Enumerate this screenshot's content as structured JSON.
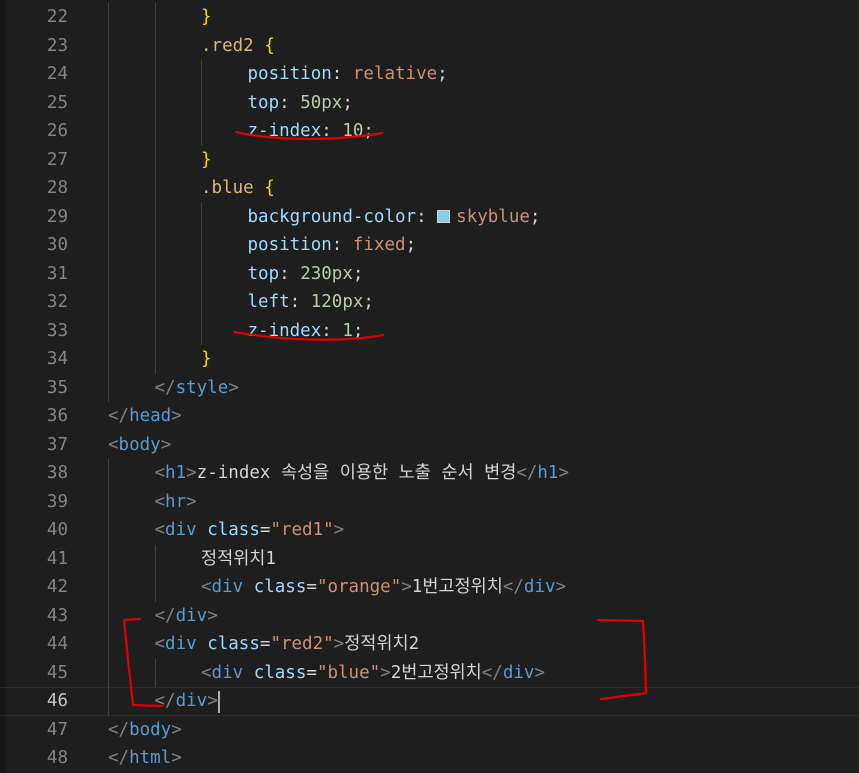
{
  "editor": {
    "swatch_color": "#87ceeb",
    "annotation_color": "#e00000",
    "current_line": 46,
    "lines": [
      {
        "n": "22",
        "indent": 2,
        "tokens": [
          [
            "t-br",
            "}"
          ]
        ]
      },
      {
        "n": "23",
        "indent": 2,
        "tokens": [
          [
            "t-sel",
            ".red2"
          ],
          [
            "t-pun",
            " "
          ],
          [
            "t-br",
            "{"
          ]
        ]
      },
      {
        "n": "24",
        "indent": 3,
        "tokens": [
          [
            "t-prop",
            "position"
          ],
          [
            "t-pun",
            ": "
          ],
          [
            "t-val",
            "relative"
          ],
          [
            "t-pun",
            ";"
          ]
        ]
      },
      {
        "n": "25",
        "indent": 3,
        "tokens": [
          [
            "t-prop",
            "top"
          ],
          [
            "t-pun",
            ": "
          ],
          [
            "t-num",
            "50px"
          ],
          [
            "t-pun",
            ";"
          ]
        ]
      },
      {
        "n": "26",
        "indent": 3,
        "tokens": [
          [
            "t-prop",
            "z-index"
          ],
          [
            "t-pun",
            ": "
          ],
          [
            "t-num",
            "10"
          ],
          [
            "t-pun",
            ";"
          ]
        ]
      },
      {
        "n": "27",
        "indent": 2,
        "tokens": [
          [
            "t-br",
            "}"
          ]
        ]
      },
      {
        "n": "28",
        "indent": 2,
        "tokens": [
          [
            "t-sel",
            ".blue"
          ],
          [
            "t-pun",
            " "
          ],
          [
            "t-br",
            "{"
          ]
        ]
      },
      {
        "n": "29",
        "indent": 3,
        "tokens": [
          [
            "t-prop",
            "background-color"
          ],
          [
            "t-pun",
            ": "
          ],
          [
            "swatch",
            ""
          ],
          [
            "t-val",
            "skyblue"
          ],
          [
            "t-pun",
            ";"
          ]
        ]
      },
      {
        "n": "30",
        "indent": 3,
        "tokens": [
          [
            "t-prop",
            "position"
          ],
          [
            "t-pun",
            ": "
          ],
          [
            "t-val",
            "fixed"
          ],
          [
            "t-pun",
            ";"
          ]
        ]
      },
      {
        "n": "31",
        "indent": 3,
        "tokens": [
          [
            "t-prop",
            "top"
          ],
          [
            "t-pun",
            ": "
          ],
          [
            "t-num",
            "230px"
          ],
          [
            "t-pun",
            ";"
          ]
        ]
      },
      {
        "n": "32",
        "indent": 3,
        "tokens": [
          [
            "t-prop",
            "left"
          ],
          [
            "t-pun",
            ": "
          ],
          [
            "t-num",
            "120px"
          ],
          [
            "t-pun",
            ";"
          ]
        ]
      },
      {
        "n": "33",
        "indent": 3,
        "tokens": [
          [
            "t-prop",
            "z-index"
          ],
          [
            "t-pun",
            ": "
          ],
          [
            "t-num",
            "1"
          ],
          [
            "t-pun",
            ";"
          ]
        ]
      },
      {
        "n": "34",
        "indent": 2,
        "tokens": [
          [
            "t-br",
            "}"
          ]
        ]
      },
      {
        "n": "35",
        "indent": 1,
        "tokens": [
          [
            "t-ang",
            "</"
          ],
          [
            "t-tag",
            "style"
          ],
          [
            "t-ang",
            ">"
          ]
        ]
      },
      {
        "n": "36",
        "indent": 0,
        "tokens": [
          [
            "t-ang",
            "</"
          ],
          [
            "t-tag",
            "head"
          ],
          [
            "t-ang",
            ">"
          ]
        ]
      },
      {
        "n": "37",
        "indent": 0,
        "tokens": [
          [
            "t-ang",
            "<"
          ],
          [
            "t-tag",
            "body"
          ],
          [
            "t-ang",
            ">"
          ]
        ]
      },
      {
        "n": "38",
        "indent": 1,
        "tokens": [
          [
            "t-ang",
            "<"
          ],
          [
            "t-tag",
            "h1"
          ],
          [
            "t-ang",
            ">"
          ],
          [
            "t-txt",
            "z-index 속성을 이용한 노출 순서 변경"
          ],
          [
            "t-ang",
            "</"
          ],
          [
            "t-tag",
            "h1"
          ],
          [
            "t-ang",
            ">"
          ]
        ]
      },
      {
        "n": "39",
        "indent": 1,
        "tokens": [
          [
            "t-ang",
            "<"
          ],
          [
            "t-tag",
            "hr"
          ],
          [
            "t-ang",
            ">"
          ]
        ]
      },
      {
        "n": "40",
        "indent": 1,
        "tokens": [
          [
            "t-ang",
            "<"
          ],
          [
            "t-tag",
            "div"
          ],
          [
            "t-pun",
            " "
          ],
          [
            "t-attr",
            "class"
          ],
          [
            "t-pun",
            "="
          ],
          [
            "t-str",
            "\"red1\""
          ],
          [
            "t-ang",
            ">"
          ]
        ]
      },
      {
        "n": "41",
        "indent": 2,
        "tokens": [
          [
            "t-txt",
            "정적위치1"
          ]
        ]
      },
      {
        "n": "42",
        "indent": 2,
        "tokens": [
          [
            "t-ang",
            "<"
          ],
          [
            "t-tag",
            "div"
          ],
          [
            "t-pun",
            " "
          ],
          [
            "t-attr",
            "class"
          ],
          [
            "t-pun",
            "="
          ],
          [
            "t-str",
            "\"orange\""
          ],
          [
            "t-ang",
            ">"
          ],
          [
            "t-txt",
            "1번고정위치"
          ],
          [
            "t-ang",
            "</"
          ],
          [
            "t-tag",
            "div"
          ],
          [
            "t-ang",
            ">"
          ]
        ]
      },
      {
        "n": "43",
        "indent": 1,
        "tokens": [
          [
            "t-ang",
            "</"
          ],
          [
            "t-tag",
            "div"
          ],
          [
            "t-ang",
            ">"
          ]
        ]
      },
      {
        "n": "44",
        "indent": 1,
        "tokens": [
          [
            "t-ang",
            "<"
          ],
          [
            "t-tag",
            "div"
          ],
          [
            "t-pun",
            " "
          ],
          [
            "t-attr",
            "class"
          ],
          [
            "t-pun",
            "="
          ],
          [
            "t-str",
            "\"red2\""
          ],
          [
            "t-ang",
            ">"
          ],
          [
            "t-txt",
            "정적위치2"
          ]
        ]
      },
      {
        "n": "45",
        "indent": 2,
        "tokens": [
          [
            "t-ang",
            "<"
          ],
          [
            "t-tag",
            "div"
          ],
          [
            "t-pun",
            " "
          ],
          [
            "t-attr",
            "class"
          ],
          [
            "t-pun",
            "="
          ],
          [
            "t-str",
            "\"blue\""
          ],
          [
            "t-ang",
            ">"
          ],
          [
            "t-txt",
            "2번고정위치"
          ],
          [
            "t-ang",
            "</"
          ],
          [
            "t-tag",
            "div"
          ],
          [
            "t-ang",
            ">"
          ]
        ]
      },
      {
        "n": "46",
        "indent": 1,
        "tokens": [
          [
            "t-ang",
            "</"
          ],
          [
            "t-tag",
            "div"
          ],
          [
            "t-ang",
            ">"
          ]
        ]
      },
      {
        "n": "47",
        "indent": 0,
        "tokens": [
          [
            "t-ang",
            "</"
          ],
          [
            "t-tag",
            "body"
          ],
          [
            "t-ang",
            ">"
          ]
        ]
      },
      {
        "n": "48",
        "indent": 0,
        "tokens": [
          [
            "t-ang",
            "</"
          ],
          [
            "t-tag",
            "html"
          ],
          [
            "t-ang",
            ">"
          ]
        ]
      }
    ]
  }
}
